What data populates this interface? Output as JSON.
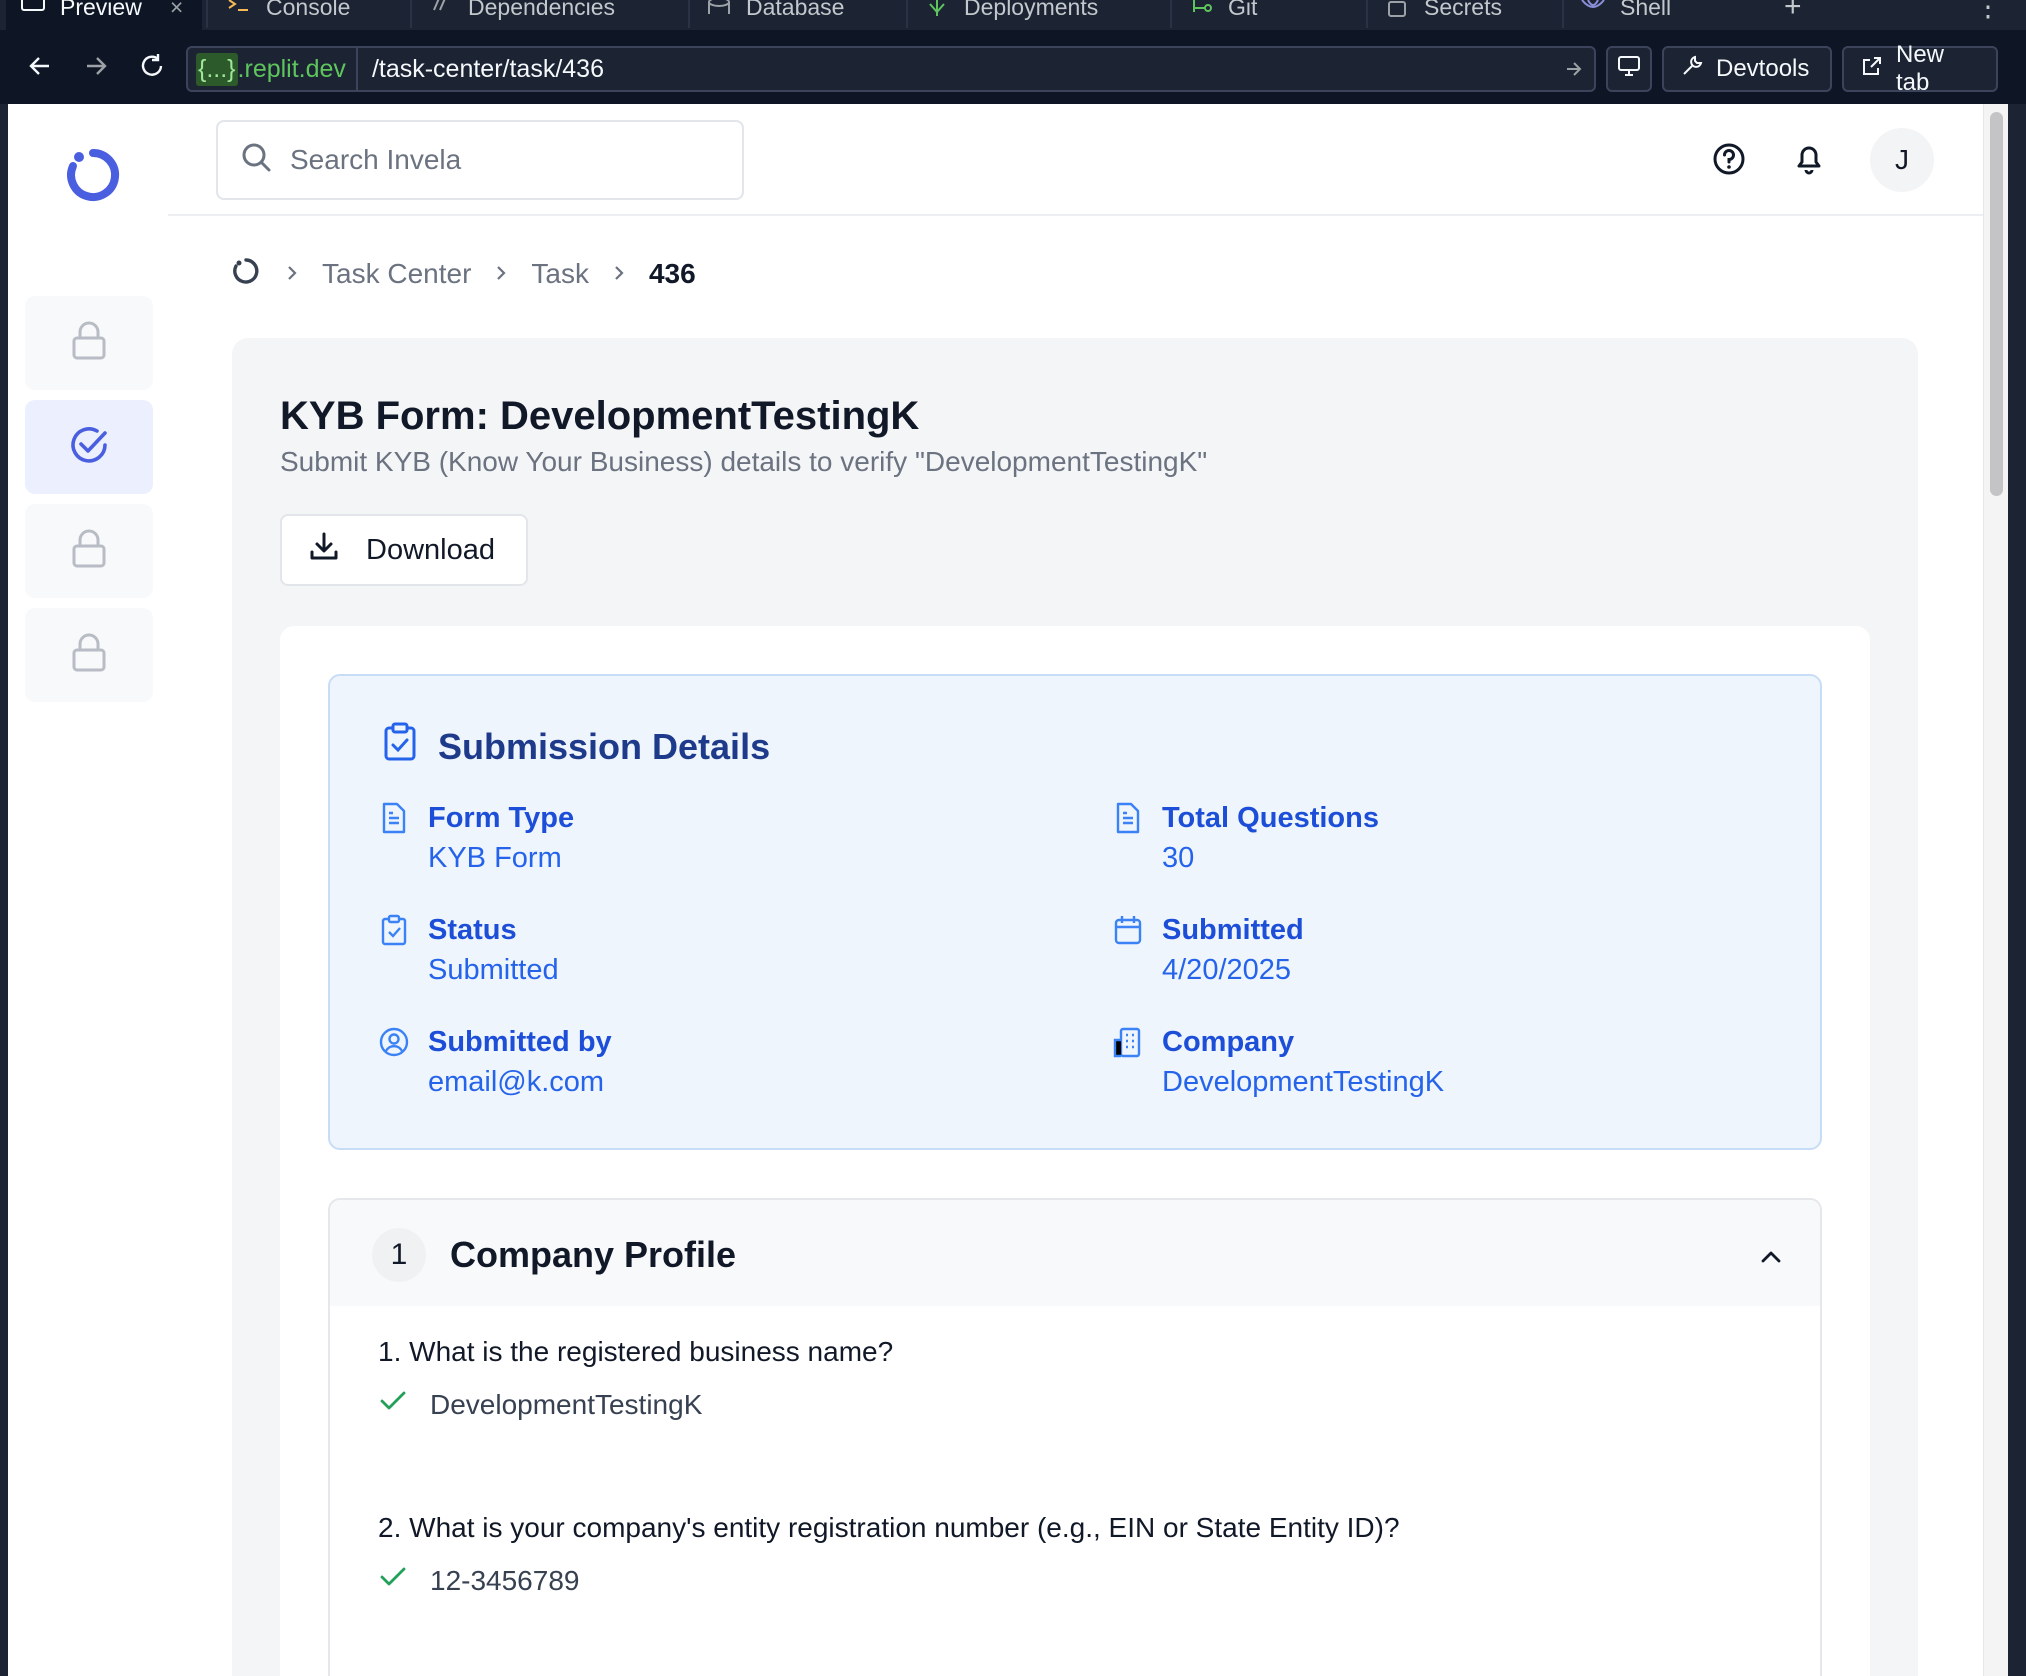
{
  "ide": {
    "tabs": [
      {
        "label": "Preview",
        "icon": "monitor-icon"
      },
      {
        "label": "Console",
        "icon": "terminal-icon"
      },
      {
        "label": "Dependencies",
        "icon": "package-icon"
      },
      {
        "label": "Database",
        "icon": "database-icon"
      },
      {
        "label": "Deployments",
        "icon": "rocket-icon"
      },
      {
        "label": "Git",
        "icon": "git-branch-icon"
      },
      {
        "label": "Secrets",
        "icon": "lock-icon"
      },
      {
        "label": "Shell",
        "icon": "shell-icon"
      }
    ],
    "close_tab_glyph": "×",
    "add_tab_glyph": "+",
    "more_glyph": "⋮",
    "url_host_braces": "{...}",
    "url_host_domain": ".replit.dev",
    "url_path": "/task-center/task/436",
    "devtools_label": "Devtools",
    "new_tab_label": "New tab"
  },
  "app": {
    "search_placeholder": "Search Invela",
    "avatar_initial": "J",
    "breadcrumb": [
      "Task Center",
      "Task",
      "436"
    ],
    "page_title": "KYB Form: DevelopmentTestingK",
    "page_subtitle": "Submit KYB (Know Your Business) details to verify \"DevelopmentTestingK\"",
    "download_label": "Download",
    "submission": {
      "title": "Submission Details",
      "fields": [
        {
          "label": "Form Type",
          "value": "KYB Form",
          "icon": "file-text-icon"
        },
        {
          "label": "Total Questions",
          "value": "30",
          "icon": "file-text-icon"
        },
        {
          "label": "Status",
          "value": "Submitted",
          "icon": "clipboard-check-icon"
        },
        {
          "label": "Submitted",
          "value": "4/20/2025",
          "icon": "calendar-icon"
        },
        {
          "label": "Submitted by",
          "value": "email@k.com",
          "icon": "user-circle-icon"
        },
        {
          "label": "Company",
          "value": "DevelopmentTestingK",
          "icon": "building-icon"
        }
      ]
    },
    "section": {
      "number": "1",
      "title": "Company Profile",
      "questions": [
        {
          "number": "1.",
          "question": "What is the registered business name?",
          "answer": "DevelopmentTestingK"
        },
        {
          "number": "2.",
          "question": "What is your company's entity registration number (e.g., EIN or State Entity ID)?",
          "answer": "12-3456789"
        }
      ]
    }
  },
  "colors": {
    "ide_bg": "#0e1525",
    "accent_blue": "#4a5fe0",
    "details_bg": "#eef5fd",
    "details_text": "#1d4ed8",
    "check_green": "#22a05a"
  }
}
